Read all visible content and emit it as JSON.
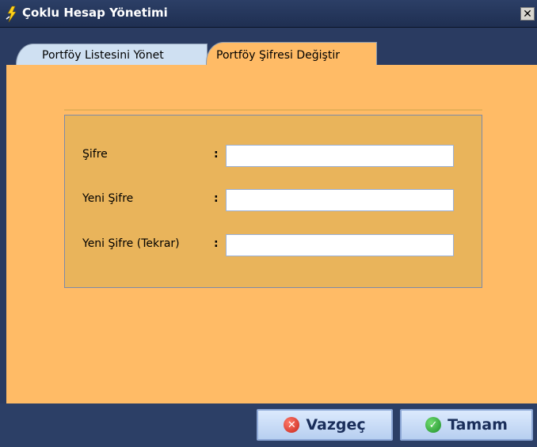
{
  "window": {
    "title": "Çoklu Hesap Yönetimi",
    "close_glyph": "✕",
    "colors": {
      "titlebar": "#2c3f66",
      "content": "#ffbb66",
      "panel": "#e9b45b"
    }
  },
  "tabs": [
    {
      "label": "Portföy Listesini Yönet",
      "active": false
    },
    {
      "label": "Portföy Şifresi Değiştir",
      "active": true
    }
  ],
  "form": {
    "fields": [
      {
        "label": "Şifre",
        "value": ""
      },
      {
        "label": "Yeni Şifre",
        "value": ""
      },
      {
        "label": "Yeni Şifre (Tekrar)",
        "value": ""
      }
    ],
    "colon": ":"
  },
  "buttons": {
    "cancel_label": "Vazgeç",
    "ok_label": "Tamam"
  },
  "icons": {
    "app": "lightning-icon",
    "cancel": "cancel-x-icon",
    "ok": "checkmark-icon"
  }
}
